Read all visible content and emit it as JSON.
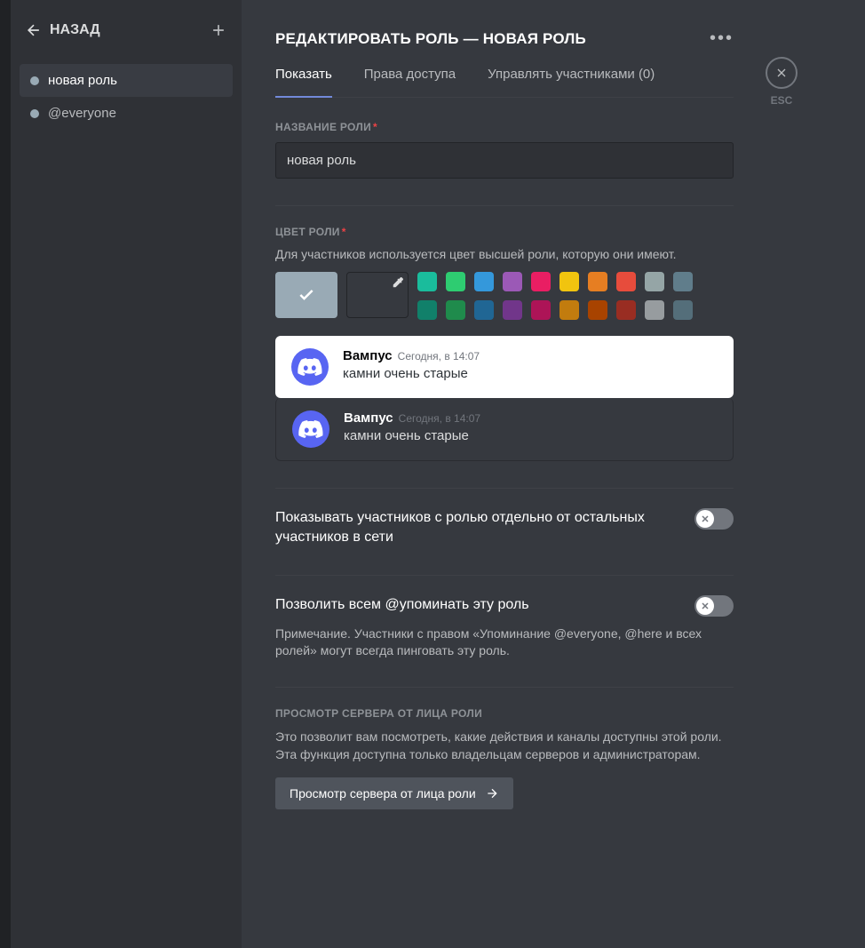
{
  "sidebar": {
    "back_label": "НАЗАД",
    "roles": [
      {
        "label": "новая роль",
        "color": "#99aab5"
      },
      {
        "label": "@everyone",
        "color": "#99aab5"
      }
    ]
  },
  "close": {
    "label": "ESC"
  },
  "header": {
    "title": "РЕДАКТИРОВАТЬ РОЛЬ — НОВАЯ РОЛЬ"
  },
  "tabs": {
    "display": "Показать",
    "permissions": "Права доступа",
    "members": "Управлять участниками (0)"
  },
  "role_name": {
    "label": "НАЗВАНИЕ РОЛИ",
    "value": "новая роль"
  },
  "role_color": {
    "label": "ЦВЕТ РОЛИ",
    "helper": "Для участников используется цвет высшей роли, которую они имеют.",
    "default": "#99aab5",
    "row1": [
      "#1abc9c",
      "#2ecc71",
      "#3498db",
      "#9b59b6",
      "#e91e63",
      "#f1c40f",
      "#e67e22",
      "#e74c3c",
      "#95a5a6",
      "#607d8b"
    ],
    "row2": [
      "#11806a",
      "#1f8b4c",
      "#206694",
      "#71368a",
      "#ad1457",
      "#c27c0e",
      "#a84300",
      "#992d22",
      "#979c9f",
      "#546e7a"
    ]
  },
  "preview": {
    "username": "Вампус",
    "timestamp": "Сегодня, в 14:07",
    "message": "камни очень старые"
  },
  "toggles": {
    "hoist": {
      "title": "Показывать участников с ролью отдельно от остальных участников в сети"
    },
    "mentionable": {
      "title": "Позволить всем @упоминать эту роль",
      "note": "Примечание. Участники с правом «Упоминание @everyone, @here и всех ролей» могут всегда пинговать эту роль."
    }
  },
  "view_as": {
    "heading": "ПРОСМОТР СЕРВЕРА ОТ ЛИЦА РОЛИ",
    "desc": "Это позволит вам посмотреть, какие действия и каналы доступны этой роли. Эта функция доступна только владельцам серверов и администраторам.",
    "button": "Просмотр сервера от лица роли"
  }
}
